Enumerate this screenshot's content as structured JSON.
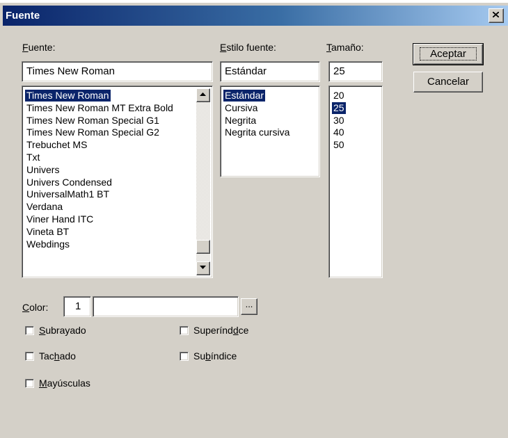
{
  "window": {
    "title": "Fuente"
  },
  "labels": {
    "font": "Fuente:",
    "style": "Estilo fuente:",
    "size": "Tamaño:",
    "color": "Color:"
  },
  "font": {
    "value": "Times New Roman",
    "items": [
      "Times New Roman",
      "Times New Roman MT Extra Bold",
      "Times New Roman Special G1",
      "Times New Roman Special G2",
      "Trebuchet MS",
      "Txt",
      "Univers",
      "Univers Condensed",
      "UniversalMath1 BT",
      "Verdana",
      "Viner Hand ITC",
      "Vineta BT",
      "Webdings"
    ],
    "selected_index": 0
  },
  "style": {
    "value": "Estándar",
    "items": [
      "Estándar",
      "Cursiva",
      "Negrita",
      "Negrita cursiva"
    ],
    "selected_index": 0
  },
  "size": {
    "value": "25",
    "items": [
      "20",
      "25",
      "30",
      "40",
      "50"
    ],
    "selected_index": 1
  },
  "buttons": {
    "accept": "Aceptar",
    "cancel": "Cancelar",
    "browse": "..."
  },
  "color": {
    "value": "1",
    "text": ""
  },
  "effects": {
    "underline": "Subrayado",
    "strikethrough": "Tachado",
    "uppercase": "Mayúsculas",
    "superscript": "Superíndice",
    "subscript": "Subíndice"
  },
  "colors": {
    "selection": "#0a246a",
    "face": "#d4d0c8",
    "title_start": "#0a246a",
    "title_end": "#a6caf0"
  },
  "icons": {
    "close": "close-icon",
    "scroll_up": "arrow-up-icon",
    "scroll_down": "arrow-down-icon"
  }
}
